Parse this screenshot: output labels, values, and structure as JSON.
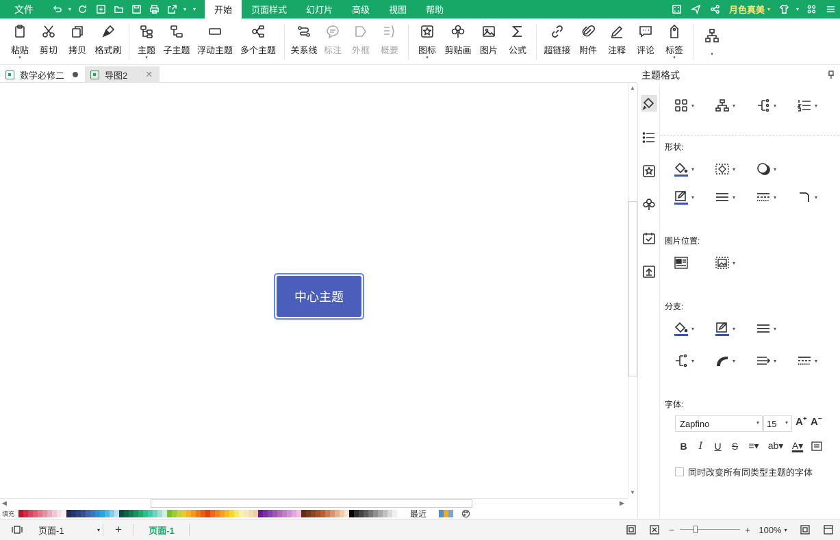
{
  "menubar": {
    "file": "文件",
    "tabs": [
      "开始",
      "页面样式",
      "幻灯片",
      "高级",
      "视图",
      "帮助"
    ],
    "active_tab": "开始",
    "user": "月色真美"
  },
  "ribbon": {
    "buttons": [
      "粘贴",
      "剪切",
      "拷贝",
      "格式刷",
      "主题",
      "子主题",
      "浮动主题",
      "多个主题",
      "关系线",
      "标注",
      "外框",
      "概要",
      "图标",
      "剪贴画",
      "图片",
      "公式",
      "超链接",
      "附件",
      "注释",
      "评论",
      "标签"
    ]
  },
  "doc_tabs": [
    {
      "title": "数学必修二"
    },
    {
      "title": "导图2"
    }
  ],
  "canvas": {
    "center_topic": "中心主题"
  },
  "palette": {
    "label": "填充",
    "recent": "最近",
    "colors": [
      "#c8102e",
      "#d42a4a",
      "#d8455f",
      "#dc5f75",
      "#e0798c",
      "#e593a4",
      "#eaadbb",
      "#f0c7d2",
      "#f6e1e9",
      "#fcedf2",
      "#1c2a5e",
      "#25366f",
      "#2e4281",
      "#384e92",
      "#4462a6",
      "#3a77b8",
      "#2f8fcb",
      "#26a4db",
      "#4ab7e4",
      "#86cdea",
      "#bfe2f2",
      "#0d4d3b",
      "#126346",
      "#177a52",
      "#1c915e",
      "#21a86a",
      "#2ebf8f",
      "#48c9a6",
      "#6fd3bd",
      "#a0e0d3",
      "#cfeee8",
      "#7cbf2e",
      "#9ccb36",
      "#c3d43a",
      "#e8cc2d",
      "#f0b321",
      "#ee9a1c",
      "#e87d17",
      "#e26013",
      "#dc430e",
      "#f26522",
      "#f58220",
      "#f7a01f",
      "#f9bd1e",
      "#fbda1d",
      "#fde968",
      "#fef3a0",
      "#f5e7c5",
      "#f2dcb0",
      "#efd09b",
      "#6a1b9a",
      "#7b2fa3",
      "#8c43ac",
      "#9d57b5",
      "#ae6bbe",
      "#bf7fc7",
      "#d093d0",
      "#e1a7d9",
      "#f2bbe2",
      "#5d2e14",
      "#733a1b",
      "#8a4722",
      "#a05329",
      "#b76030",
      "#c97b4e",
      "#d9966c",
      "#e6b18a",
      "#f1cca8",
      "#f8e6d3",
      "#000000",
      "#2b2b2b",
      "#444444",
      "#5d5d5d",
      "#767676",
      "#8f8f8f",
      "#a8a8a8",
      "#c1c1c1",
      "#dadada",
      "#f0f0f0",
      "#ffffff"
    ],
    "recent_colors": [
      "#4a90d9",
      "#f5a623",
      "#7ba7d6"
    ]
  },
  "panel": {
    "title": "主题格式",
    "shape": "形状:",
    "image_position": "图片位置:",
    "branch": "分支:",
    "font": "字体:",
    "font_name": "Zapfino",
    "font_size": "15",
    "same_font_label": "同时改变所有同类型主题的字体"
  },
  "statusbar": {
    "page_select": "页面-1",
    "page_tab": "页面-1",
    "zoom": "100%"
  },
  "colors": {
    "accent": "#17a868",
    "topic_fill": "#4b5fba",
    "topic_border": "#6a82ff",
    "user": "#ffe36e"
  }
}
